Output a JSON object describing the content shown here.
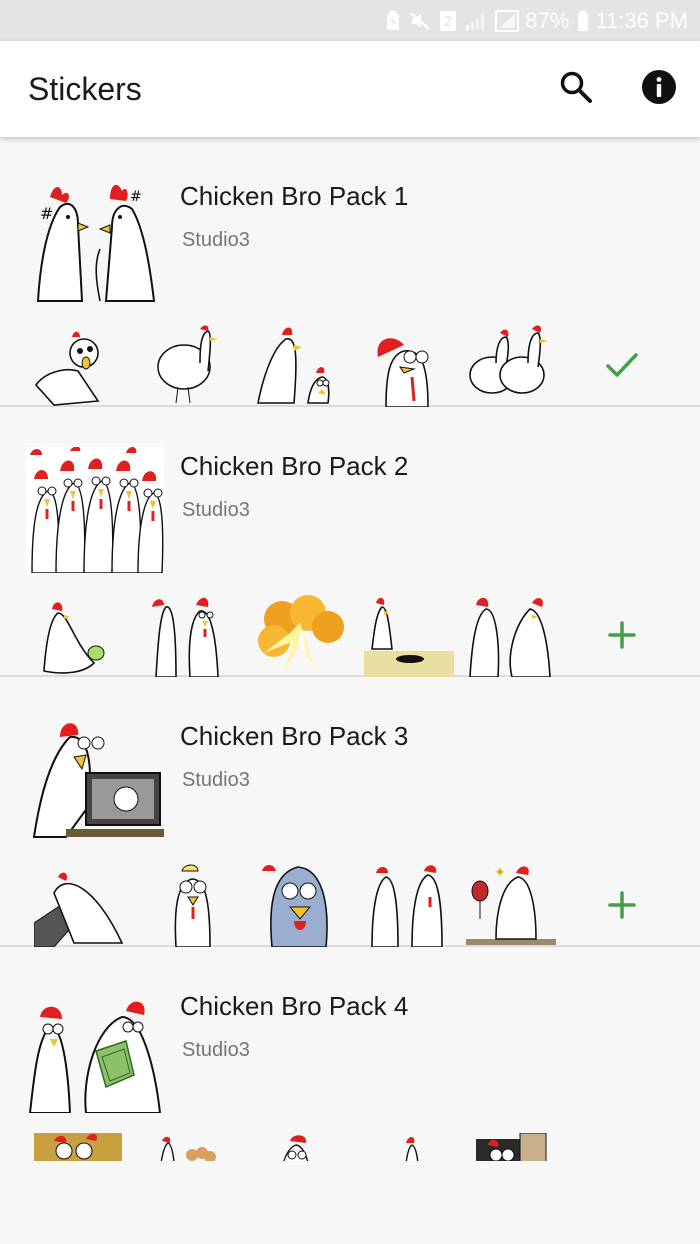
{
  "status_bar": {
    "battery": "87%",
    "time": "11:36 PM",
    "sim_badge": "2"
  },
  "app_bar": {
    "title": "Stickers",
    "search_icon": "search-icon",
    "info_icon": "info-icon"
  },
  "packs": [
    {
      "name": "Chicken Bro Pack 1",
      "author": "Studio3",
      "action": "added",
      "action_icon": "check-icon"
    },
    {
      "name": "Chicken Bro Pack 2",
      "author": "Studio3",
      "action": "add",
      "action_icon": "plus-icon"
    },
    {
      "name": "Chicken Bro Pack 3",
      "author": "Studio3",
      "action": "add",
      "action_icon": "plus-icon"
    },
    {
      "name": "Chicken Bro Pack 4",
      "author": "Studio3",
      "action": "add",
      "action_icon": "plus-icon"
    }
  ],
  "colors": {
    "accent_green": "#43a047",
    "comb_red": "#e02020",
    "beak_yellow": "#f2c230"
  }
}
